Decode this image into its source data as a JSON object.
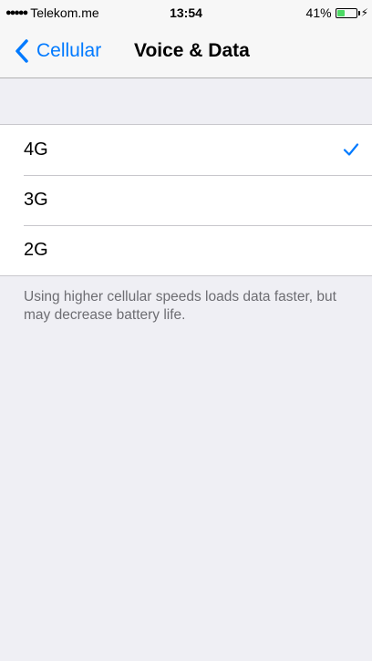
{
  "status_bar": {
    "signal": "●●●●●",
    "carrier": "Telekom.me",
    "time": "13:54",
    "battery_percent": "41%",
    "battery_level": 0.41
  },
  "nav": {
    "back_label": "Cellular",
    "title": "Voice & Data"
  },
  "options": [
    {
      "label": "4G",
      "selected": true
    },
    {
      "label": "3G",
      "selected": false
    },
    {
      "label": "2G",
      "selected": false
    }
  ],
  "footer": "Using higher cellular speeds loads data faster, but may decrease battery life.",
  "colors": {
    "accent": "#007aff",
    "battery_fill": "#4cd964",
    "background": "#efeff4",
    "footer_text": "#6d6d72"
  },
  "icons": {
    "back": "chevron-left-icon",
    "selected": "checkmark-icon",
    "battery": "battery-icon",
    "charging": "bolt-icon"
  }
}
